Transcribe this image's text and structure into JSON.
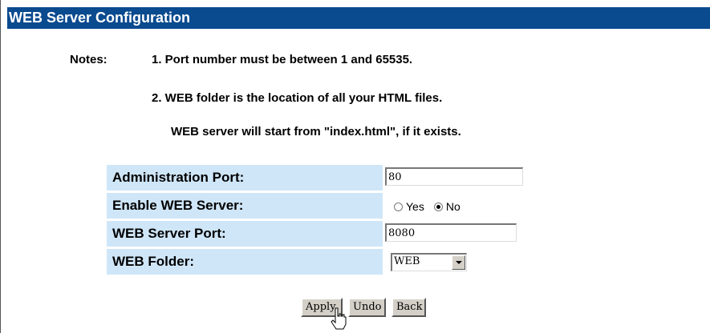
{
  "header": {
    "title": "WEB Server Configuration"
  },
  "notes": {
    "label": "Notes:",
    "line1": "1. Port number must be between 1 and 65535.",
    "line2": "2. WEB folder is the location of all your HTML files.",
    "line3": "WEB server will start from \"index.html\", if it exists."
  },
  "form": {
    "admin_port": {
      "label": "Administration Port:",
      "value": "80"
    },
    "enable_web": {
      "label": "Enable WEB Server:",
      "options": [
        "Yes",
        "No"
      ],
      "selected": "No"
    },
    "web_port": {
      "label": "WEB Server Port:",
      "value": "8080"
    },
    "web_folder": {
      "label": "WEB Folder:",
      "value": "WEB"
    }
  },
  "buttons": {
    "apply": "Apply",
    "undo": "Undo",
    "back": "Back"
  },
  "colors": {
    "title_bg": "#0a4a8f",
    "label_bg": "#cfe6f8",
    "button_bg": "#d4d0c8"
  },
  "icons": {
    "cursor": "hand-cursor-icon"
  }
}
